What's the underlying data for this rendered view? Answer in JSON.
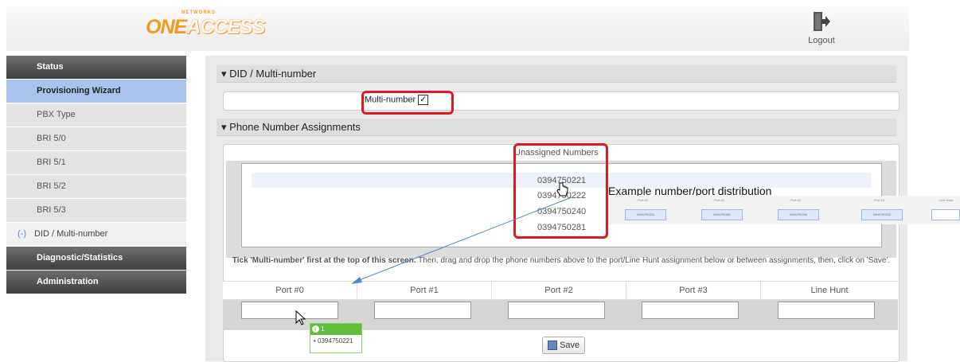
{
  "header": {
    "logo_main": "ONE",
    "logo_access": "ACCESS",
    "logo_networks": "NETWORKS",
    "logout_label": "Logout"
  },
  "sidebar": {
    "items": [
      {
        "label": "Status"
      },
      {
        "label": "Provisioning Wizard"
      },
      {
        "label": "PBX Type"
      },
      {
        "label": "BRI 5/0"
      },
      {
        "label": "BRI 5/1"
      },
      {
        "label": "BRI 5/2"
      },
      {
        "label": "BRI 5/3"
      },
      {
        "label": "DID / Multi-number",
        "marker": "(-)"
      },
      {
        "label": "Diagnostic/Statistics"
      },
      {
        "label": "Administration"
      }
    ]
  },
  "did_section": {
    "title": "DID / Multi-number",
    "multi_number_label": "Multi-number",
    "multi_number_checked": true
  },
  "assign_section": {
    "title": "Phone Number Assignments",
    "unassigned_label": "Unassigned Numbers",
    "numbers": [
      "0394750221",
      "0394750222",
      "0394750240",
      "0394750281"
    ],
    "instructions_bold": "Tick 'Multi-number' first at the top of this screen.",
    "instructions_rest": " Then, drag and drop the phone numbers above to the port/Line Hunt assignment below or between assignments, then, click on 'Save'.",
    "ports": [
      "Port #0",
      "Port #1",
      "Port #2",
      "Port #3",
      "Line Hunt"
    ],
    "save_label": "Save"
  },
  "drag_tooltip": {
    "count": "1",
    "number": "0394750221"
  },
  "example": {
    "caption": "Example number/port distribution",
    "headers": [
      "Port #0",
      "Port #1",
      "Port #2",
      "Port #3",
      "Line Hunt"
    ],
    "cells": [
      "0394750221",
      "0394750281",
      "0394750240",
      "0394750222"
    ]
  },
  "colors": {
    "highlight_red": "#e0191f",
    "sidebar_blue": "#aac3ec",
    "brand_orange": "#f39a1e",
    "arrow_blue": "#4a86d0"
  }
}
